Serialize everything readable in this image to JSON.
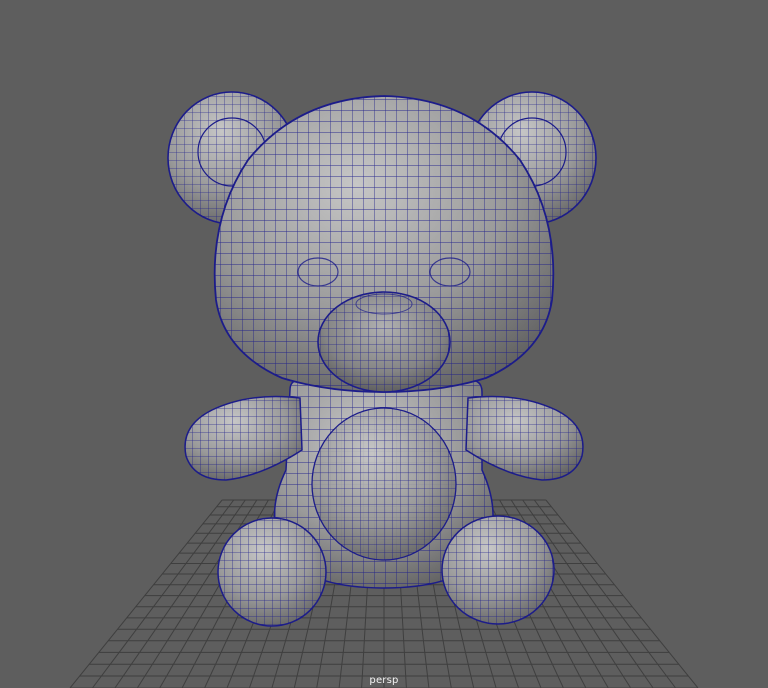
{
  "viewport": {
    "camera_name": "persp",
    "background_color": "#5e5e5e",
    "grid_color": "#3f3f3f",
    "wireframe_color": "#1c1c8a",
    "mesh_shade_light": "#b8b8b8",
    "mesh_shade_dark": "#5a5a5a"
  },
  "model": {
    "subject": "teddy bear",
    "display_mode": "wireframe-on-shaded"
  }
}
